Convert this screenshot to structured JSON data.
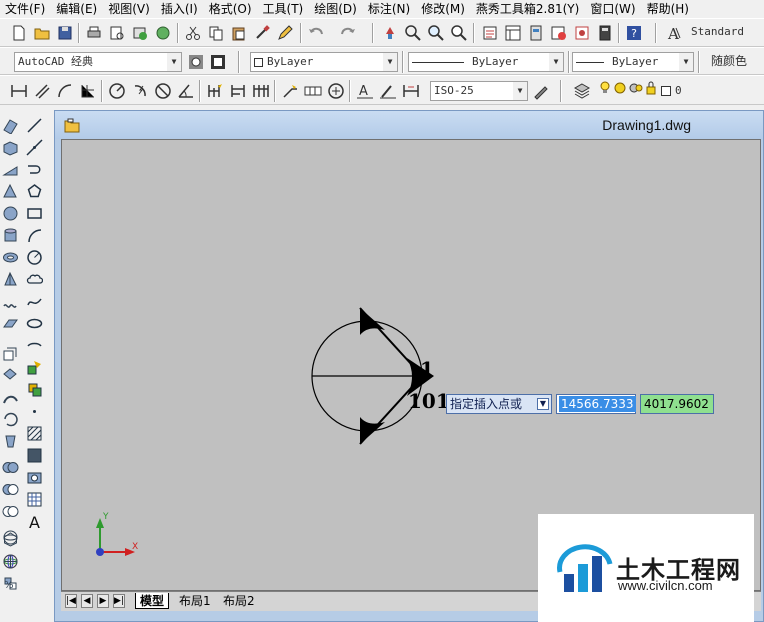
{
  "menu": [
    "文件(F)",
    "编辑(E)",
    "视图(V)",
    "插入(I)",
    "格式(O)",
    "工具(T)",
    "绘图(D)",
    "标注(N)",
    "修改(M)",
    "燕秀工具箱2.81(Y)",
    "窗口(W)",
    "帮助(H)"
  ],
  "toolbar": {
    "text_style": "Standard",
    "workspace": "AutoCAD 经典",
    "layer": "ByLayer",
    "linetype": "ByLayer",
    "lineweight": "ByLayer",
    "plot_style": "随颜色",
    "dim_style": "ISO-25",
    "layer_value": "0"
  },
  "document": {
    "title": "Drawing1.dwg"
  },
  "canvas": {
    "label_top": "1",
    "label_bottom": "101",
    "ucs_x": "X",
    "ucs_y": "Y"
  },
  "dynamic_input": {
    "prompt": "指定插入点或",
    "x_value": "14566.7333",
    "y_value": "4017.9602"
  },
  "layout_tabs": [
    "模型",
    "布局1",
    "布局2"
  ],
  "watermark": {
    "name": "土木工程网",
    "url": "www.civilcn.com"
  },
  "colors": {
    "canvas_bg": "#c0c0c0",
    "input_highlight": "#3a8ee6",
    "input_green": "#8fe08f",
    "window_frame": "#b6cce6"
  }
}
